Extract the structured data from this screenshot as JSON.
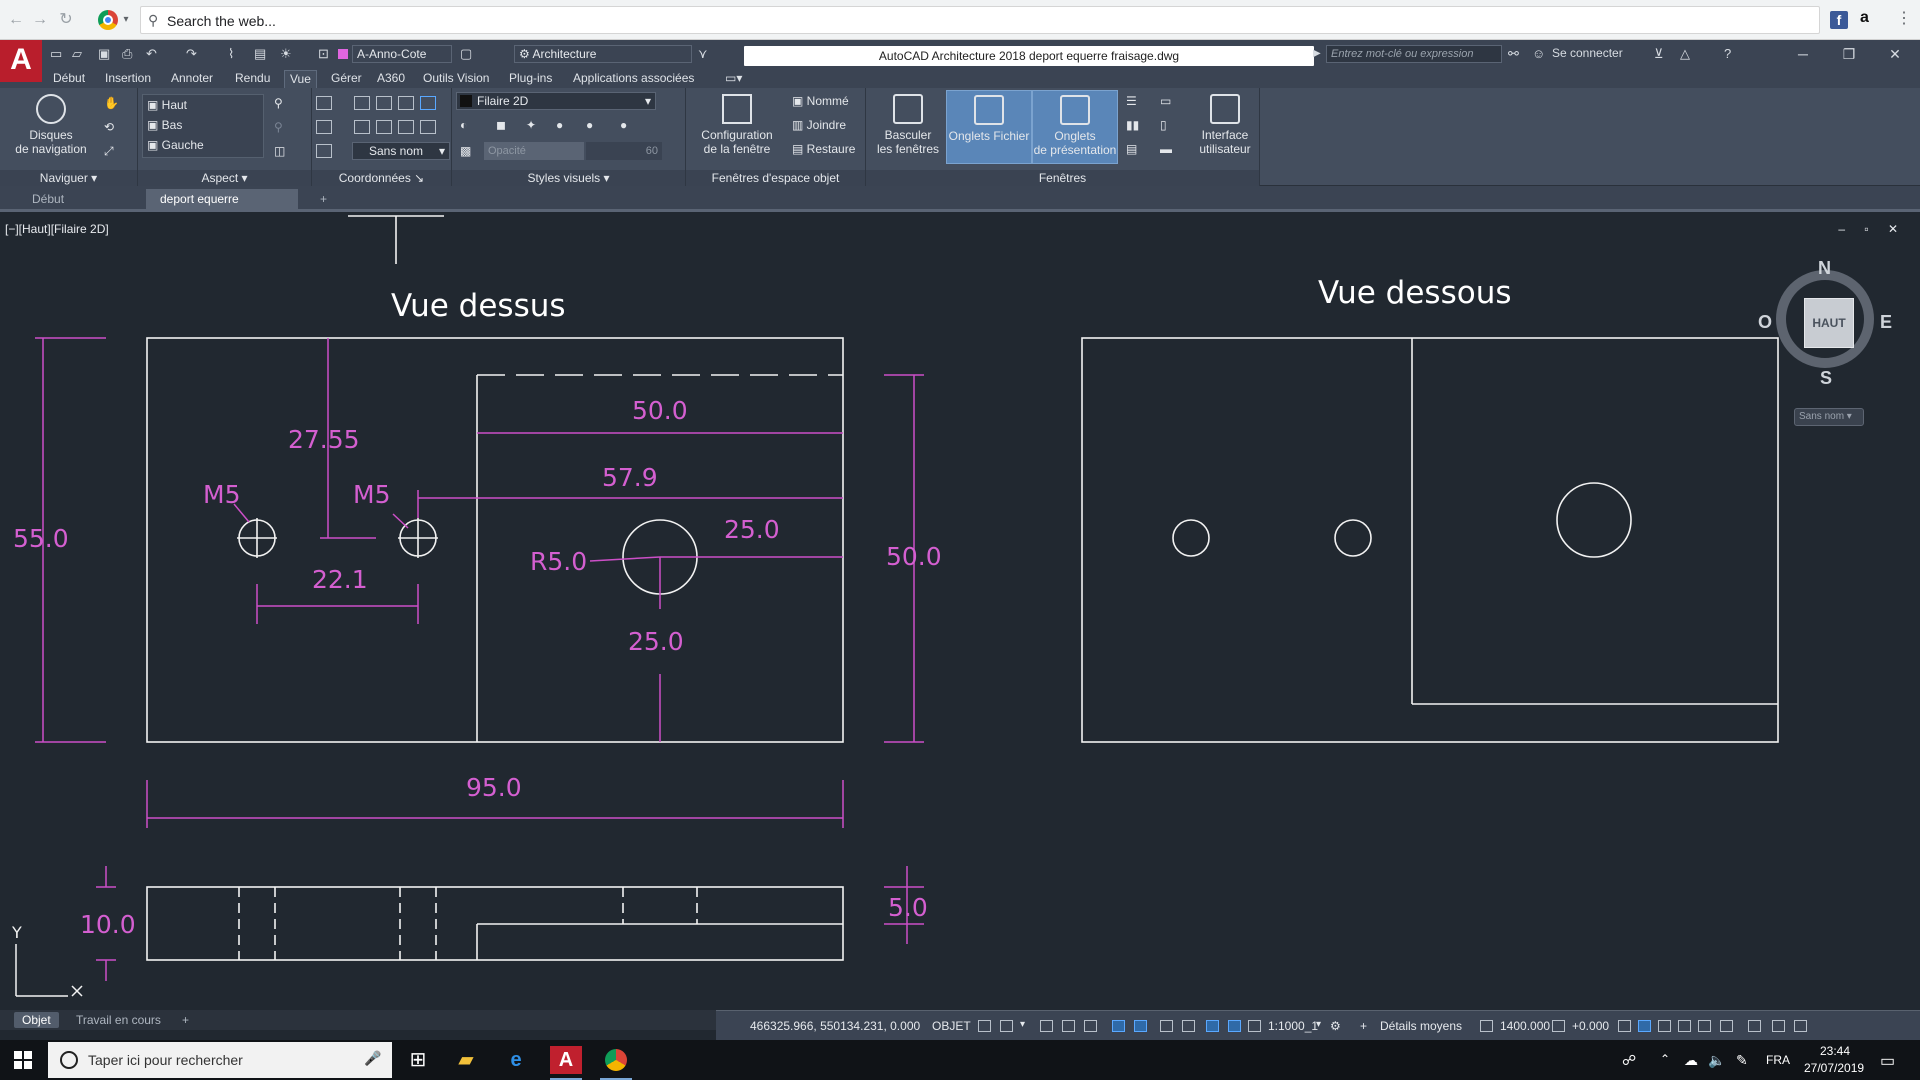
{
  "browser": {
    "omnibox_placeholder": "Search the web...",
    "ext_facebook": "f",
    "ext_amazon": "a"
  },
  "app": {
    "logo": "A",
    "workspace_annotation": "A-Anno-Cote",
    "workspace": "Architecture",
    "title": "AutoCAD Architecture 2018   deport equerre fraisage.dwg",
    "search_placeholder": "Entrez mot-clé ou expression",
    "signin": "Se connecter"
  },
  "ribbon_tabs": [
    "Début",
    "Insertion",
    "Annoter",
    "Rendu",
    "Vue",
    "Gérer",
    "A360",
    "Outils Vision",
    "Plug-ins",
    "Applications associées"
  ],
  "ribbon": {
    "navigate": {
      "wheel_label_1": "Disques",
      "wheel_label_2": "de navigation",
      "panel": "Naviguer"
    },
    "views": {
      "items": [
        "Haut",
        "Bas",
        "Gauche"
      ],
      "panel": "Aspect"
    },
    "coords": {
      "ucs_name": "Sans nom",
      "panel": "Coordonnées"
    },
    "visual": {
      "style": "Filaire 2D",
      "opacity_label": "Opacité",
      "opacity_value": "60",
      "panel": "Styles visuels"
    },
    "model_viewports": {
      "config_1": "Configuration",
      "config_2": "de la fenêtre",
      "named": "Nommé",
      "join": "Joindre",
      "restore": "Restaure",
      "panel": "Fenêtres d'espace objet"
    },
    "windows": {
      "switch_1": "Basculer",
      "switch_2": "les fenêtres",
      "file_tabs": "Onglets Fichier",
      "layout_tabs_1": "Onglets",
      "layout_tabs_2": "de présentation",
      "panel": "Fenêtres"
    },
    "ui": {
      "label_1": "Interface",
      "label_2": "utilisateur"
    }
  },
  "doc_tabs": [
    "Début",
    "deport equerre fraisage"
  ],
  "viewport": {
    "label": "[−][Haut][Filaire 2D]",
    "controls": "– ▫ ✕"
  },
  "drawing": {
    "title_top": "Vue dessus",
    "title_bottom": "Vue dessous",
    "dims": {
      "d55": "55.0",
      "d27_55": "27.55",
      "d50_top": "50.0",
      "d57_9": "57.9",
      "m5_a": "M5",
      "m5_b": "M5",
      "r5": "R5.0",
      "d25_h": "25.0",
      "d22_1": "22.1",
      "d25_v": "25.0",
      "d50_right": "50.0",
      "d95": "95.0",
      "d10": "10.0",
      "d5": "5.0"
    }
  },
  "viewcube": {
    "face": "HAUT",
    "north": "N",
    "south": "S",
    "east": "E",
    "west": "O",
    "wcs": "Sans nom"
  },
  "ucs": {
    "y": "Y"
  },
  "layout_tabs": [
    "Objet",
    "Travail en cours"
  ],
  "status": {
    "coords": "466325.966, 550134.231, 0.000",
    "space": "OBJET",
    "scale": "1:1000_1",
    "detail": "Détails moyens",
    "elevation": "1400.000",
    "offset": "+0.000"
  },
  "taskbar": {
    "search": "Taper ici pour rechercher",
    "lang": "FRA",
    "time": "23:44",
    "date": "27/07/2019"
  },
  "colors": {
    "dimension": "#cc4fc7",
    "geometry": "#f2f2f2",
    "background": "#212830",
    "accent": "#5a86b8"
  }
}
